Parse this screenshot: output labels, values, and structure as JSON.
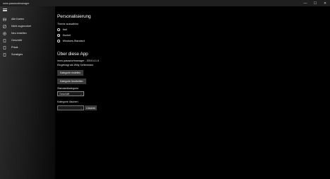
{
  "window": {
    "title": "mms.passwortmanager"
  },
  "nav": {
    "items": [
      {
        "label": "Alle Karten"
      },
      {
        "label": "Nicht zugeordnet"
      },
      {
        "label": "Neu erstellen"
      },
      {
        "label": "Geschäft"
      },
      {
        "label": "Privat"
      },
      {
        "label": "Sonstiges"
      }
    ]
  },
  "settings": {
    "title": "Personalisierung",
    "theme_label": "Theme auswählen",
    "themes": [
      {
        "label": "Hell",
        "selected": false
      },
      {
        "label": "Dunkel",
        "selected": true
      },
      {
        "label": "Windows-Standard",
        "selected": false
      }
    ]
  },
  "about": {
    "title": "Über diese App",
    "version": "mms.passwortmanager - 2019.4.1.0",
    "owner": "Eingetragt als Willy Seitermann",
    "create_category_button": "Kategorie erstellen",
    "edit_category_button": "Kategorie bearbeiten",
    "default_category_label": "Standardkategorie",
    "default_category_value": "Geschäft",
    "delete_category_label": "Kategorie löschen",
    "delete_category_value": "",
    "delete_button": "Löschen"
  }
}
